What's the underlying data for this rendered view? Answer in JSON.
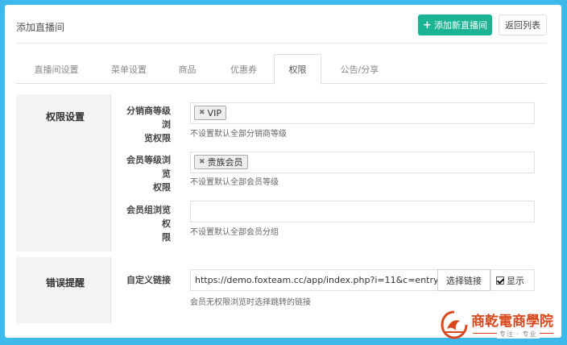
{
  "header": {
    "title": "添加直播间",
    "add_button": "添加新直播间",
    "back_button": "返回列表"
  },
  "tabs": [
    {
      "label": "直播间设置"
    },
    {
      "label": "菜单设置"
    },
    {
      "label": "商品"
    },
    {
      "label": "优惠券"
    },
    {
      "label": "权限",
      "active": true
    },
    {
      "label": "公告/分享"
    }
  ],
  "permission": {
    "title": "权限设置",
    "fields": [
      {
        "label_line1": "分销商等级浏",
        "label_line2": "览权限",
        "tag": "VIP",
        "help": "不设置默认全部分销商等级"
      },
      {
        "label_line1": "会员等级浏览",
        "label_line2": "权限",
        "tag": "贵族会员",
        "help": "不设置默认全部会员等级"
      },
      {
        "label_line1": "会员组浏览权",
        "label_line2": "限",
        "tag": "",
        "help": "不设置默认全部会员分组"
      }
    ]
  },
  "error": {
    "title": "错误提醒",
    "label": "自定义链接",
    "url_value": "https://demo.foxteam.cc/app/index.php?i=11&c=entry",
    "choose_button": "选择链接",
    "show_label": "显示",
    "show_checked": true,
    "help": "会员无权限浏览时选择跳转的链接"
  },
  "watermark": {
    "brand": "商乾電商學院",
    "slogan": "专注 · 专业",
    "color": "#d9481c"
  },
  "colors": {
    "background": "#3fb8ec",
    "primary": "#1ab394"
  }
}
